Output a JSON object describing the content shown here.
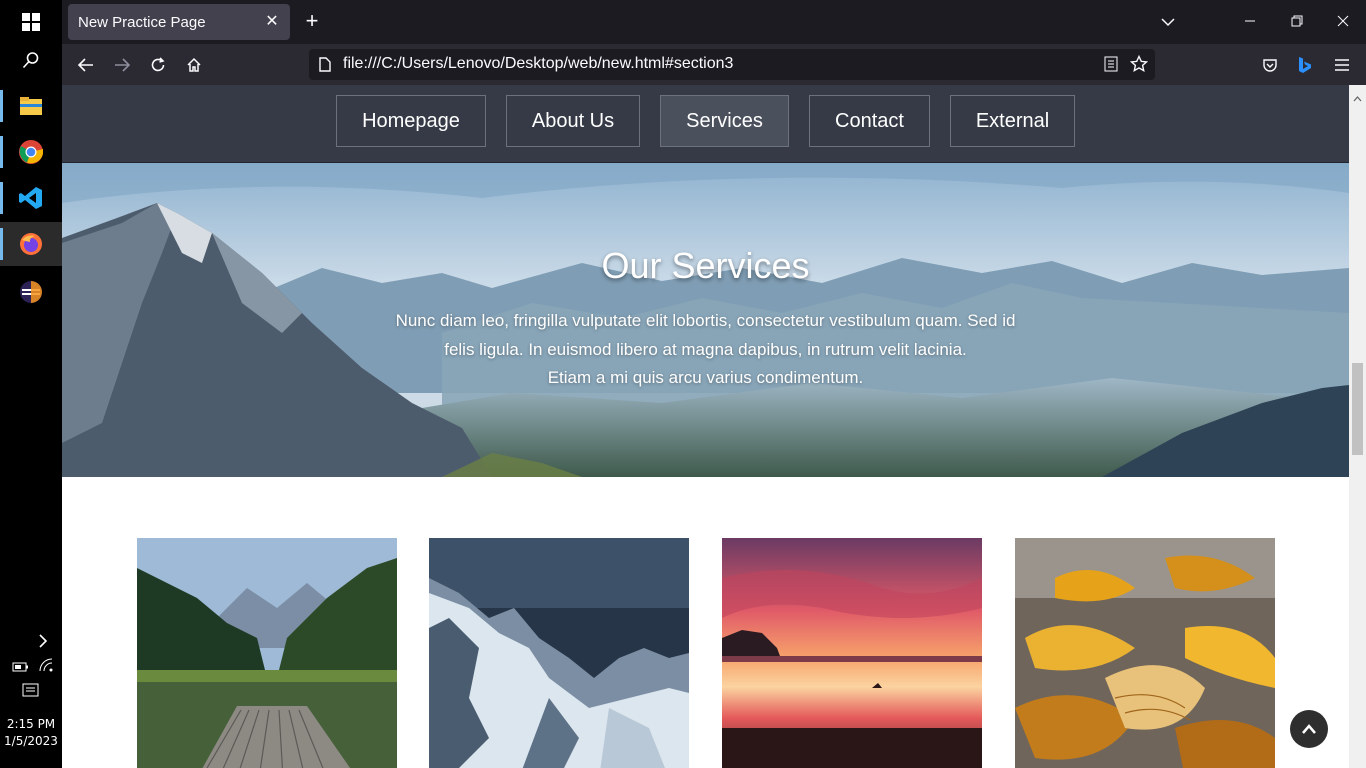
{
  "taskbar": {
    "time": "2:15 PM",
    "date": "1/5/2023",
    "apps": [
      {
        "name": "file-explorer-icon"
      },
      {
        "name": "chrome-icon"
      },
      {
        "name": "vscode-icon"
      },
      {
        "name": "firefox-icon"
      },
      {
        "name": "eclipse-icon"
      }
    ]
  },
  "browser": {
    "tab_title": "New Practice Page",
    "url": "file:///C:/Users/Lenovo/Desktop/web/new.html#section3"
  },
  "site": {
    "menu": [
      {
        "label": "Homepage",
        "active": false
      },
      {
        "label": "About Us",
        "active": false
      },
      {
        "label": "Services",
        "active": true
      },
      {
        "label": "Contact",
        "active": false
      },
      {
        "label": "External",
        "active": false
      }
    ],
    "hero": {
      "title": "Our Services",
      "text_line1": "Nunc diam leo, fringilla vulputate elit lobortis, consectetur vestibulum quam. Sed id",
      "text_line2": "felis ligula. In euismod libero at magna dapibus, in rutrum velit lacinia.",
      "text_line3": "Etiam a mi quis arcu varius condimentum."
    },
    "gallery": [
      {
        "name": "lake-dock-image"
      },
      {
        "name": "snowy-mountains-image"
      },
      {
        "name": "beach-sunset-image"
      },
      {
        "name": "autumn-leaves-image"
      }
    ]
  },
  "colors": {
    "site_nav_bg": "#363a46",
    "menu_active_bg": "#4b505d",
    "browser_dark": "#1c1b22",
    "toolbar": "#2b2a33"
  }
}
